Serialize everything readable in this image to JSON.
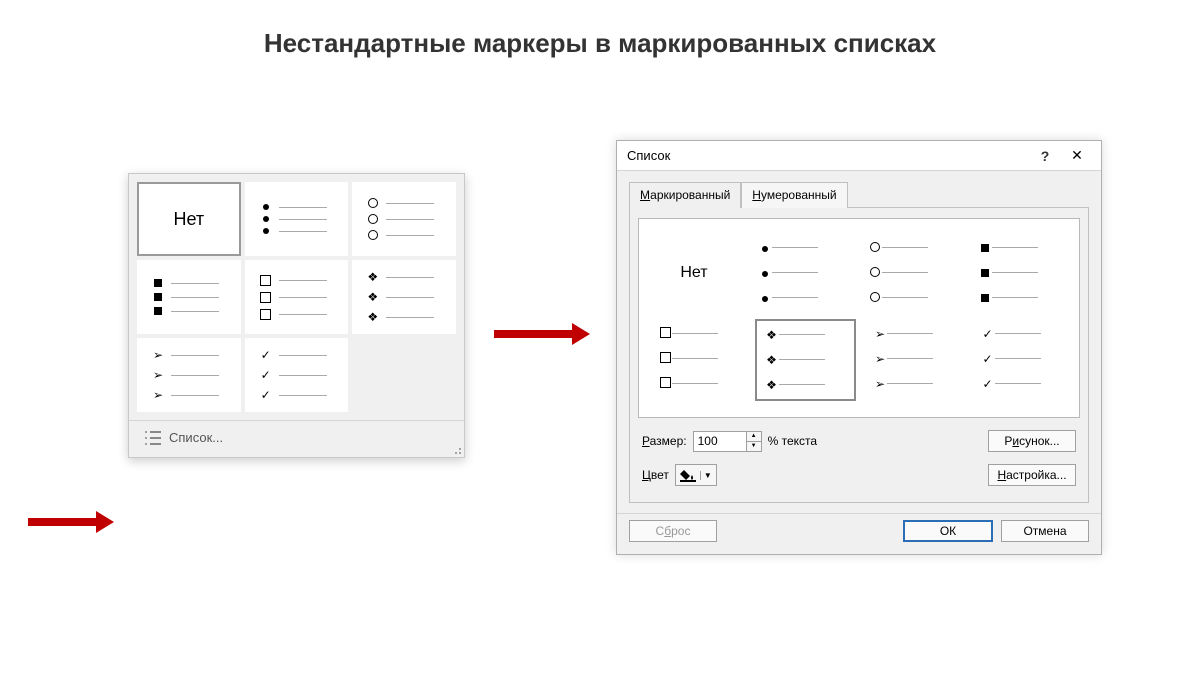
{
  "title": "Нестандартные маркеры в маркированных списках",
  "popup": {
    "none_label": "Нет",
    "list_btn": "Список..."
  },
  "dialog": {
    "window_title": "Список",
    "tab_bulleted": "Маркированный",
    "tab_bulleted_accel": "М",
    "tab_numbered": "Нумерованный",
    "tab_numbered_accel": "Н",
    "preview_none": "Нет",
    "size_label": "Размер:",
    "size_accel": "Р",
    "size_value": "100",
    "size_unit": "% текста",
    "color_label": "Цвет",
    "color_accel": "Ц",
    "picture_btn": "Рисунок...",
    "picture_accel": "и",
    "customize_btn": "Настройка...",
    "customize_accel": "Н",
    "reset_btn": "Сброс",
    "reset_accel": "б",
    "ok_btn": "ОК",
    "cancel_btn": "Отмена"
  },
  "bullets": {
    "dot": "●",
    "circle": "○",
    "sq_small": "■",
    "sq_outline": "□",
    "diamond4": "❖",
    "arrowhead": "➢",
    "check": "✓"
  }
}
